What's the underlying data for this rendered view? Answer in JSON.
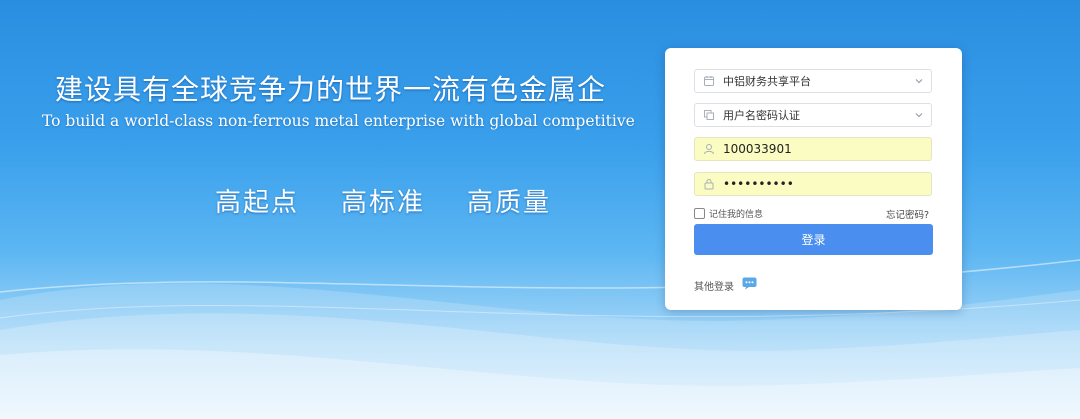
{
  "banner": {
    "slogan_cn": "建设具有全球竞争力的世界一流有色金属企",
    "slogan_en": "To build a world-class non-ferrous metal enterprise with global competitive",
    "mottos": [
      "高起点",
      "高标准",
      "高质量"
    ]
  },
  "login": {
    "platform_select": "中铝财务共享平台",
    "auth_select": "用户名密码认证",
    "username": "100033901",
    "password": "••••••••••",
    "remember_label": "记住我的信息",
    "forgot_label": "忘记密码?",
    "login_button": "登录",
    "other_login_label": "其他登录"
  },
  "icons": {
    "platform": "calendar-icon",
    "auth": "copy-icon",
    "username": "user-icon",
    "password": "lock-icon",
    "dropdown": "chevron-down-icon",
    "other_login": "chat-icon"
  },
  "colors": {
    "primary_button": "#4a8ff0",
    "autofill": "#fafcc2",
    "background": "#3aa0ec"
  }
}
